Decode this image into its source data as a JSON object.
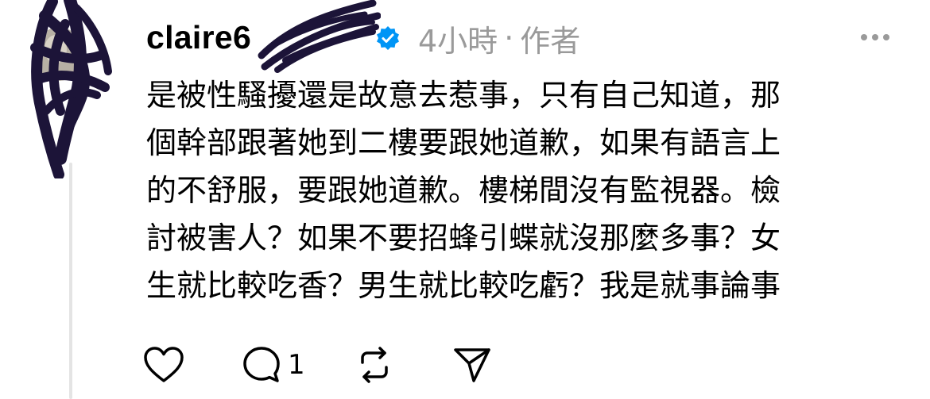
{
  "post": {
    "username": "claire6",
    "time": "4小時",
    "separator": "·",
    "author_label": "作者",
    "comment_lines": [
      "是被性騷擾還是故意去惹事，只有自己知道，那",
      "個幹部跟著她到二樓要跟她道歉，如果有語言上",
      "的不舒服，要跟她道歉。樓梯間沒有監視器。檢",
      "討被害人？如果不要招蜂引蝶就沒那麼多事？女",
      "生就比較吃香？男生就比較吃虧？我是就事論事"
    ]
  },
  "actions": {
    "like_icon": "heart-icon",
    "reply_icon": "comment-bubble-icon",
    "reply_count": "1",
    "repost_icon": "repost-icon",
    "share_icon": "paper-plane-icon"
  },
  "colors": {
    "verified": "#0095f6",
    "meta_text": "#9a9a9a",
    "scribble": "#1c1438",
    "thread_line": "#e4e4e4"
  }
}
